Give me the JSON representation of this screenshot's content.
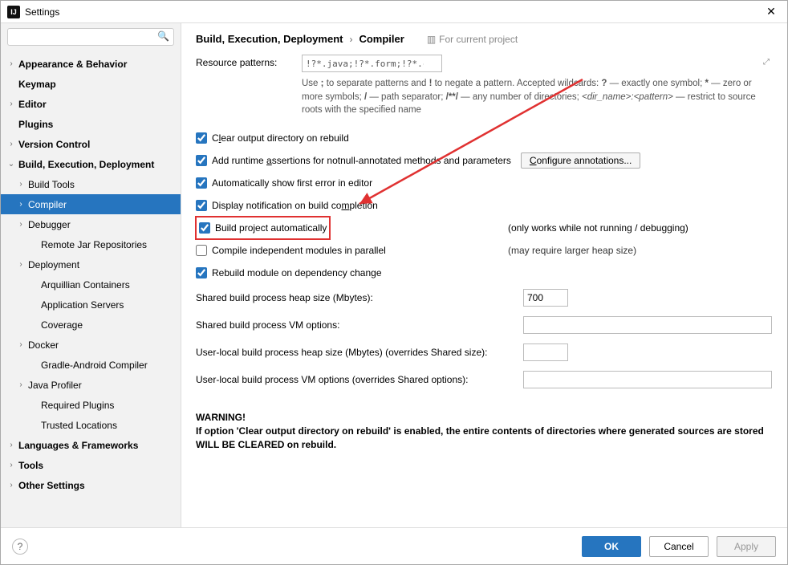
{
  "window": {
    "title": "Settings"
  },
  "search": {
    "placeholder": ""
  },
  "sidebar": {
    "items": [
      {
        "label": "Appearance & Behavior",
        "chev": "›",
        "bold": true,
        "indent": 0
      },
      {
        "label": "Keymap",
        "chev": "",
        "bold": true,
        "indent": 0
      },
      {
        "label": "Editor",
        "chev": "›",
        "bold": true,
        "indent": 0
      },
      {
        "label": "Plugins",
        "chev": "",
        "bold": true,
        "indent": 0
      },
      {
        "label": "Version Control",
        "chev": "›",
        "bold": true,
        "indent": 0
      },
      {
        "label": "Build, Execution, Deployment",
        "chev": "⌄",
        "bold": true,
        "indent": 0
      },
      {
        "label": "Build Tools",
        "chev": "›",
        "bold": false,
        "indent": 1
      },
      {
        "label": "Compiler",
        "chev": "›",
        "bold": false,
        "indent": 1,
        "selected": true
      },
      {
        "label": "Debugger",
        "chev": "›",
        "bold": false,
        "indent": 1
      },
      {
        "label": "Remote Jar Repositories",
        "chev": "",
        "bold": false,
        "indent": 2
      },
      {
        "label": "Deployment",
        "chev": "›",
        "bold": false,
        "indent": 1
      },
      {
        "label": "Arquillian Containers",
        "chev": "",
        "bold": false,
        "indent": 2
      },
      {
        "label": "Application Servers",
        "chev": "",
        "bold": false,
        "indent": 2
      },
      {
        "label": "Coverage",
        "chev": "",
        "bold": false,
        "indent": 2
      },
      {
        "label": "Docker",
        "chev": "›",
        "bold": false,
        "indent": 1
      },
      {
        "label": "Gradle-Android Compiler",
        "chev": "",
        "bold": false,
        "indent": 2
      },
      {
        "label": "Java Profiler",
        "chev": "›",
        "bold": false,
        "indent": 1
      },
      {
        "label": "Required Plugins",
        "chev": "",
        "bold": false,
        "indent": 2
      },
      {
        "label": "Trusted Locations",
        "chev": "",
        "bold": false,
        "indent": 2
      },
      {
        "label": "Languages & Frameworks",
        "chev": "›",
        "bold": true,
        "indent": 0
      },
      {
        "label": "Tools",
        "chev": "›",
        "bold": true,
        "indent": 0
      },
      {
        "label": "Other Settings",
        "chev": "›",
        "bold": true,
        "indent": 0
      }
    ]
  },
  "breadcrumb": {
    "parent": "Build, Execution, Deployment",
    "sep": "›",
    "current": "Compiler",
    "scope": "For current project"
  },
  "patterns": {
    "label": "Resource patterns:",
    "value": "!?*.java;!?*.form;!?*.class;!?*.groovy;!?*.scala;!?*.flex;!?*.kt;!?*.clj;!?*.aj;!?*.html"
  },
  "help_parts": {
    "p1": "Use ",
    "semi": ";",
    "p2": " to separate patterns and ",
    "bang": "!",
    "p3": " to negate a pattern. Accepted wildcards: ",
    "q": "?",
    "p4": " — exactly one symbol; ",
    "star": "*",
    "p5": " — zero or more symbols; ",
    "slash": "/",
    "p6": " — path separator; ",
    "dstar": "/**/",
    "p7": " — any number of directories; ",
    "dirpat": "<dir_name>:<pattern>",
    "p8": " — restrict to source roots with the specified name"
  },
  "checks": {
    "clear": "Clear output directory on rebuild",
    "assert": "Add runtime assertions for notnull-annotated methods and parameters",
    "configure": "Configure annotations...",
    "firsterr": "Automatically show first error in editor",
    "notify": "Display notification on build completion",
    "autobuild": "Build project automatically",
    "autobuild_note": "(only works while not running / debugging)",
    "parallel": "Compile independent modules in parallel",
    "parallel_note": "(may require larger heap size)",
    "rebuild_dep": "Rebuild module on dependency change"
  },
  "fields": {
    "heap": {
      "label": "Shared build process heap size (Mbytes):",
      "value": "700"
    },
    "vmopts": {
      "label": "Shared build process VM options:",
      "value": ""
    },
    "userheap": {
      "label": "User-local build process heap size (Mbytes) (overrides Shared size):",
      "value": ""
    },
    "uservm": {
      "label": "User-local build process VM options (overrides Shared options):",
      "value": ""
    }
  },
  "warning": {
    "head": "WARNING!",
    "body": "If option 'Clear output directory on rebuild' is enabled, the entire contents of directories where generated sources are stored WILL BE CLEARED on rebuild."
  },
  "footer": {
    "ok": "OK",
    "cancel": "Cancel",
    "apply": "Apply"
  }
}
